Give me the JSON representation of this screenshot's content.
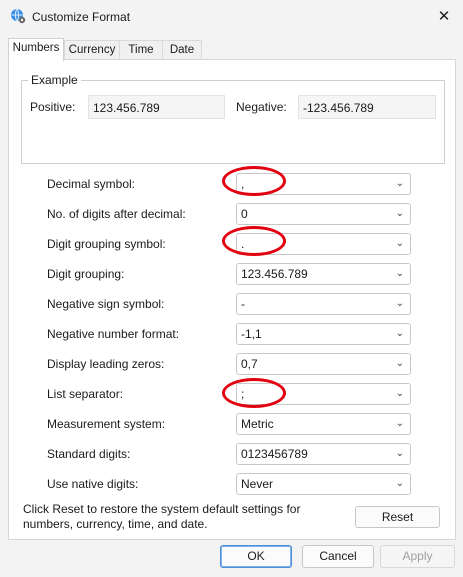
{
  "window": {
    "title": "Customize Format",
    "close_glyph": "✕"
  },
  "tabs": [
    {
      "label": "Numbers",
      "active": true
    },
    {
      "label": "Currency",
      "active": false
    },
    {
      "label": "Time",
      "active": false
    },
    {
      "label": "Date",
      "active": false
    }
  ],
  "example": {
    "group_label": "Example",
    "positive_label": "Positive:",
    "positive_value": "123.456.789",
    "negative_label": "Negative:",
    "negative_value": "-123.456.789"
  },
  "settings": [
    {
      "label": "Decimal symbol:",
      "value": ","
    },
    {
      "label": "No. of digits after decimal:",
      "value": "0"
    },
    {
      "label": "Digit grouping symbol:",
      "value": "."
    },
    {
      "label": "Digit grouping:",
      "value": "123.456.789"
    },
    {
      "label": "Negative sign symbol:",
      "value": "-"
    },
    {
      "label": "Negative number format:",
      "value": "-1,1"
    },
    {
      "label": "Display leading zeros:",
      "value": "0,7"
    },
    {
      "label": "List separator:",
      "value": ";"
    },
    {
      "label": "Measurement system:",
      "value": "Metric"
    },
    {
      "label": "Standard digits:",
      "value": "0123456789"
    },
    {
      "label": "Use native digits:",
      "value": "Never"
    }
  ],
  "reset": {
    "text": "Click Reset to restore the system default settings for numbers, currency, time, and date.",
    "button_label": "Reset"
  },
  "footer": {
    "ok_label": "OK",
    "cancel_label": "Cancel",
    "apply_label": "Apply",
    "apply_enabled": false
  },
  "icons": {
    "app_icon": "globe-gear-icon",
    "chevron": "chevron-down-icon"
  },
  "colors": {
    "highlight_circle": "#e3000f",
    "accent": "#0067c0"
  }
}
